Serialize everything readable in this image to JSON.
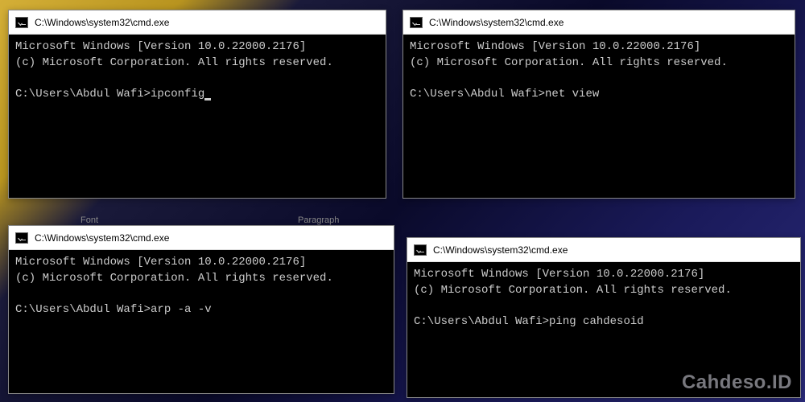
{
  "windows": {
    "w1": {
      "title": "C:\\Windows\\system32\\cmd.exe",
      "line1": "Microsoft Windows [Version 10.0.22000.2176]",
      "line2": "(c) Microsoft Corporation. All rights reserved.",
      "prompt": "C:\\Users\\Abdul Wafi>",
      "command": "ipconfig"
    },
    "w2": {
      "title": "C:\\Windows\\system32\\cmd.exe",
      "line1": "Microsoft Windows [Version 10.0.22000.2176]",
      "line2": "(c) Microsoft Corporation. All rights reserved.",
      "prompt": "C:\\Users\\Abdul Wafi>",
      "command": "net view"
    },
    "w3": {
      "title": "C:\\Windows\\system32\\cmd.exe",
      "line1": "Microsoft Windows [Version 10.0.22000.2176]",
      "line2": "(c) Microsoft Corporation. All rights reserved.",
      "prompt": "C:\\Users\\Abdul Wafi>",
      "command": "arp -a -v"
    },
    "w4": {
      "title": "C:\\Windows\\system32\\cmd.exe",
      "line1": "Microsoft Windows [Version 10.0.22000.2176]",
      "line2": "(c) Microsoft Corporation. All rights reserved.",
      "prompt": "C:\\Users\\Abdul Wafi>",
      "command": "ping cahdesoid"
    }
  },
  "watermark": "Cahdeso.ID",
  "bg_fragments": {
    "f1": "Font",
    "f2": "Paragraph"
  }
}
